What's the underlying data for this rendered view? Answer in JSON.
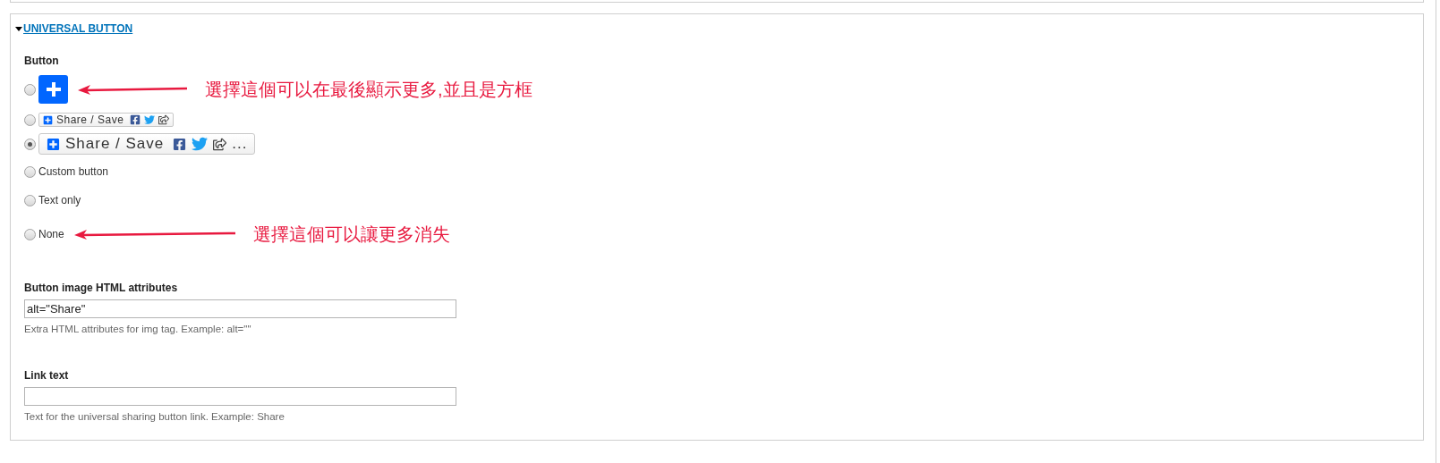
{
  "section": {
    "title": "UNIVERSAL BUTTON",
    "expanded": true
  },
  "button_field": {
    "label": "Button",
    "options": [
      {
        "kind": "square",
        "selected": false,
        "annotation": "選擇這個可以在最後顯示更多,並且是方框"
      },
      {
        "kind": "small",
        "selected": false,
        "text": "Share / Save"
      },
      {
        "kind": "large",
        "selected": true,
        "text": "Share / Save",
        "more": "..."
      },
      {
        "kind": "text",
        "selected": false,
        "text": "Custom button"
      },
      {
        "kind": "text",
        "selected": false,
        "text": "Text only"
      },
      {
        "kind": "text",
        "selected": false,
        "text": "None",
        "annotation": "選擇這個可以讓更多消失"
      }
    ]
  },
  "attributes_field": {
    "label": "Button image HTML attributes",
    "value": "alt=\"Share\"",
    "help": "Extra HTML attributes for img tag. Example: alt=\"\""
  },
  "link_text_field": {
    "label": "Link text",
    "help": "Text for the universal sharing button link. Example: Share"
  }
}
